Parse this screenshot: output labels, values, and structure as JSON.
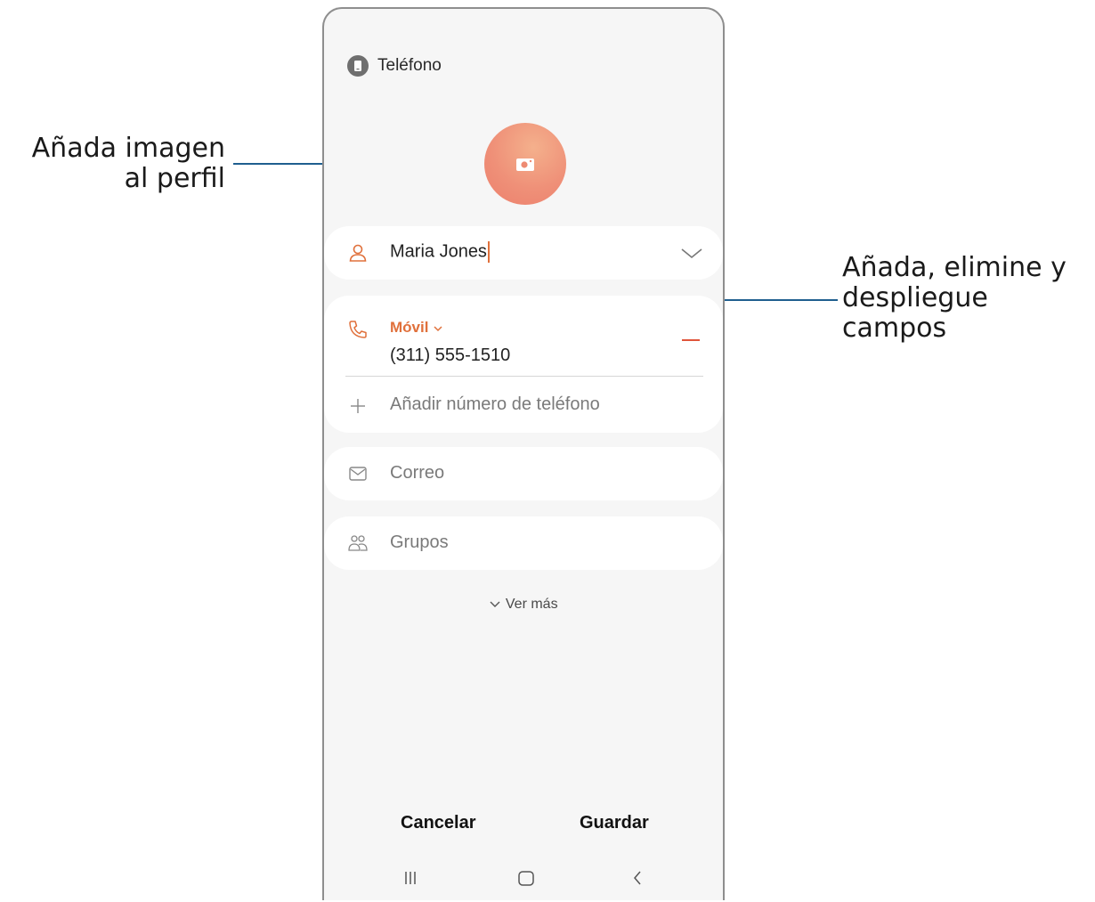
{
  "account": {
    "label": "Teléfono",
    "icon": "phone-icon"
  },
  "avatar": {
    "icon": "camera-icon",
    "color": "#ef9078"
  },
  "name_field": {
    "value": "Maria Jones",
    "icon": "person-icon"
  },
  "phone_field": {
    "type_label": "Móvil",
    "value": "(311) 555-1510",
    "icon": "phone-handset-icon"
  },
  "add_phone": {
    "label": "Añadir número de teléfono",
    "icon": "plus-icon"
  },
  "email_field": {
    "placeholder": "Correo",
    "icon": "envelope-icon"
  },
  "groups_field": {
    "placeholder": "Grupos",
    "icon": "people-icon"
  },
  "see_more": {
    "label": "Ver más",
    "icon": "chevron-down-icon"
  },
  "actions": {
    "cancel": "Cancelar",
    "save": "Guardar"
  },
  "navigation": {
    "recent": "recent-apps-icon",
    "home": "home-icon",
    "back": "back-icon"
  },
  "callouts": {
    "profile_image": [
      "Añada imagen",
      "al perfil"
    ],
    "fields": [
      "Añada, elimine y",
      "despliegue",
      "campos"
    ]
  },
  "colors": {
    "accent": "#e0703b",
    "callout_line": "#1f5f8f"
  }
}
